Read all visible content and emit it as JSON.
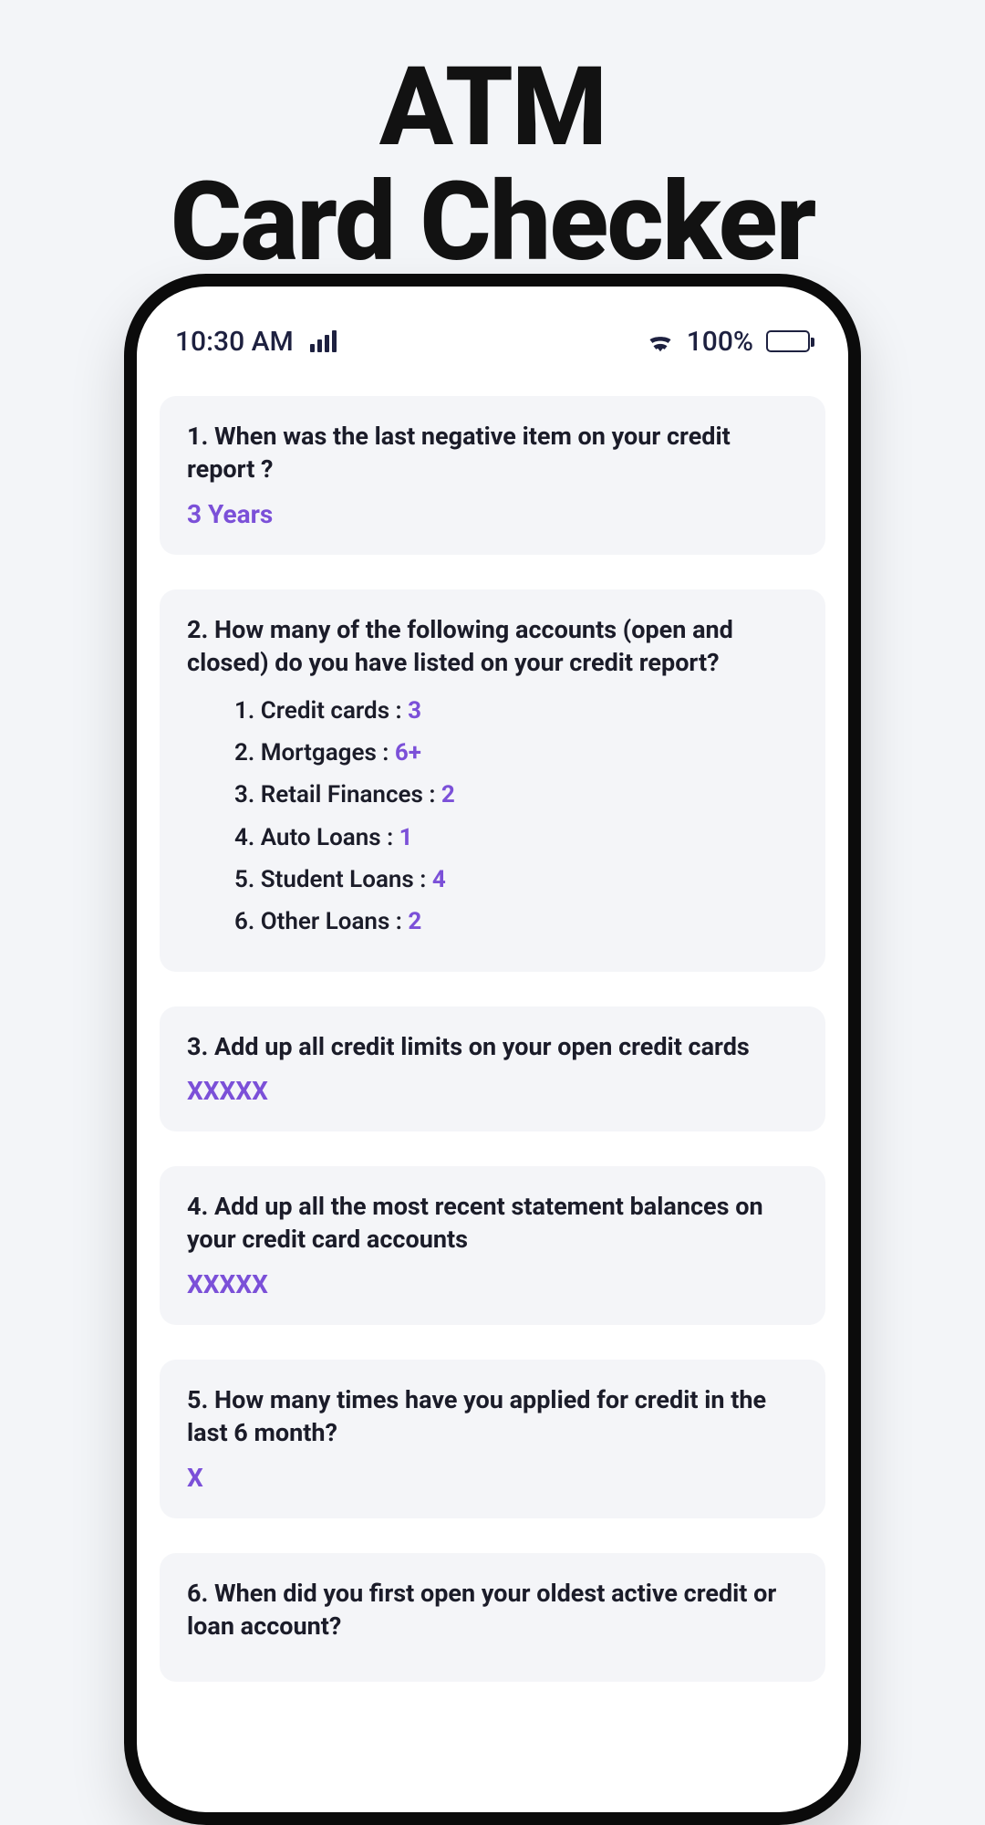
{
  "appTitle": {
    "line1": "ATM",
    "line2": "Card Checker"
  },
  "statusBar": {
    "time": "10:30 AM",
    "battery": "100%"
  },
  "colors": {
    "accent": "#7b50d8",
    "cardBg": "#f4f5f8",
    "pageBg": "#f3f5f8",
    "text": "#1b1c29"
  },
  "questions": [
    {
      "q": "1. When was the last negative item on your credit report ?",
      "a": "3 Years"
    },
    {
      "q": "2. How many of the following accounts (open and closed) do you have listed on your credit report?",
      "accounts": [
        {
          "idx": "1.",
          "label": "Credit cards : ",
          "value": "3"
        },
        {
          "idx": "2.",
          "label": "Mortgages : ",
          "value": "6+"
        },
        {
          "idx": "3.",
          "label": "Retail Finances : ",
          "value": "2"
        },
        {
          "idx": "4.",
          "label": "Auto Loans : ",
          "value": "1"
        },
        {
          "idx": "5.",
          "label": "Student Loans : ",
          "value": "4"
        },
        {
          "idx": "6.",
          "label": "Other Loans : ",
          "value": "2"
        }
      ]
    },
    {
      "q": "3. Add up all credit limits on your open credit cards",
      "a": "XXXXX"
    },
    {
      "q": "4. Add up all the most recent statement balances on your credit card accounts",
      "a": "XXXXX"
    },
    {
      "q": "5. How many times have you applied for credit in the last 6 month?",
      "a": "X"
    },
    {
      "q": "6. When did you first open your oldest active credit or loan account?"
    }
  ]
}
